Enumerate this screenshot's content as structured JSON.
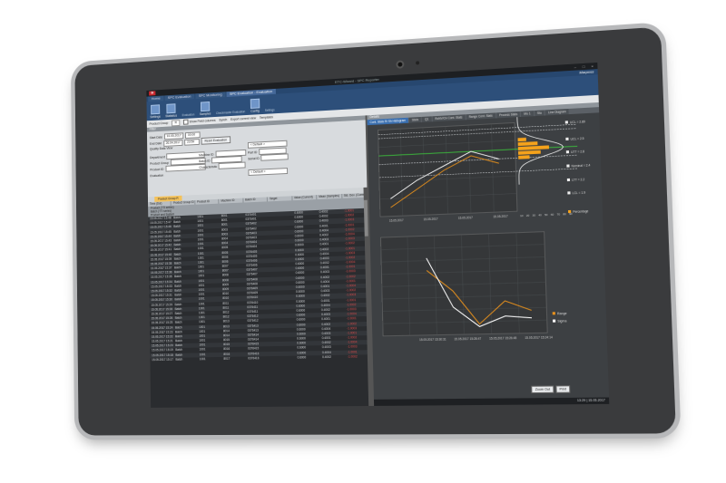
{
  "window": {
    "logo": "SI",
    "title": "ETC-Wizard - SPC Reporter",
    "min": "–",
    "max": "□",
    "close": "×"
  },
  "tabs": [
    "Home",
    "SPC Evaluation",
    "SPC Monitoring",
    "SPC Evaluation - Evaluation"
  ],
  "active_tab": 3,
  "brand": "Marposs",
  "ribbon": {
    "buttons": [
      "Settings",
      "Statistics",
      "Samples",
      "Config"
    ],
    "groups": [
      "Evaluation",
      "Checkmaster Evaluation",
      "Settings"
    ]
  },
  "toolbar": {
    "product_group_label": "Product Group",
    "product_group_value": "R",
    "show_fields": "Show Field columns",
    "synch": "Synch",
    "export": "Export current view",
    "templates": "Templates"
  },
  "filter": {
    "title": "Filter",
    "start_label": "Start Date",
    "start_value": "10.05.2017",
    "start_time": "00:00",
    "end_label": "End Date",
    "end_value": "26.04.2017",
    "end_time": "23:59",
    "reset_button": "Reset Evaluation",
    "quality_label": "Quality Data View",
    "default": "< Default >",
    "labels": [
      "Department",
      "Product Group",
      "Product ID",
      "Evaluation"
    ],
    "labels2": [
      "Machine ID",
      "Batch ID",
      "Characteristic"
    ],
    "labels3": [
      "Part ID",
      "Serial ID"
    ]
  },
  "grid": {
    "tab": "Product Group R",
    "headers": [
      "Time (Dat)",
      "Product Group ID",
      "Product ID",
      "Machine ID",
      "Batch ID",
      "Target",
      "Value (Current)",
      "Mean (Samples)",
      "Std. Dev. (Current)"
    ],
    "subrows": [
      "Product (TTI series)",
      "Batch (TTI series)",
      "Product and System"
    ],
    "rows": [
      [
        "15.05.2017 15:48:08",
        "Batch",
        "1001",
        "8001",
        "0376401",
        "",
        "0.6000",
        "0.4002",
        "-1.0001"
      ],
      [
        "15.05.2017 15:47:57",
        "Batch",
        "1001",
        "8001",
        "0376401",
        "",
        "0.6000",
        "0.4002",
        "-1.0002"
      ],
      [
        "15.05.2017 15:46:33",
        "Batch",
        "1001",
        "8001",
        "0376402",
        "",
        "0.6000",
        "0.4003",
        "-1.0003"
      ],
      [
        "15.05.2017 15:45:16",
        "Batch",
        "1001",
        "8003",
        "0376402",
        "",
        "0.6000",
        "0.4001",
        "-1.0001"
      ],
      [
        "15.05.2017 15:44:51",
        "Batch",
        "1001",
        "8003",
        "0376403",
        "",
        "0.6000",
        "0.4004",
        "-1.0002"
      ],
      [
        "15.05.2017 15:43:40",
        "Batch",
        "1001",
        "8004",
        "0376403",
        "",
        "0.6000",
        "0.4002",
        "-1.0004"
      ],
      [
        "15.05.2017 15:42:27",
        "Batch",
        "1001",
        "8004",
        "0376404",
        "",
        "0.6000",
        "0.4003",
        "-1.0003"
      ],
      [
        "15.05.2017 15:41:09",
        "Batch",
        "1001",
        "8005",
        "0376404",
        "",
        "0.6000",
        "0.4001",
        "-1.0002"
      ],
      [
        "15.05.2017 15:40:38",
        "Batch",
        "1001",
        "8005",
        "0376405",
        "",
        "0.6000",
        "0.4002",
        "-1.0001"
      ],
      [
        "15.05.2017 15:39:21",
        "Batch",
        "1001",
        "8006",
        "0376405",
        "",
        "0.6000",
        "0.4004",
        "-1.0003"
      ],
      [
        "15.05.2017 15:38:02",
        "Batch",
        "1001",
        "8006",
        "0376406",
        "",
        "0.6000",
        "0.4003",
        "-1.0002"
      ],
      [
        "15.05.2017 15:37:44",
        "Batch",
        "1001",
        "8007",
        "0376406",
        "",
        "0.6000",
        "0.4002",
        "-1.0004"
      ],
      [
        "15.05.2017 15:36:29",
        "Batch",
        "1001",
        "8007",
        "0376407",
        "",
        "0.6000",
        "0.4001",
        "-1.0001"
      ],
      [
        "15.05.2017 15:35:13",
        "Batch",
        "1001",
        "8008",
        "0376407",
        "",
        "0.6000",
        "0.4003",
        "-1.0003"
      ],
      [
        "15.05.2017 15:34:50",
        "Batch",
        "1001",
        "8008",
        "0376408",
        "",
        "0.6000",
        "0.4002",
        "-1.0002"
      ],
      [
        "15.05.2017 15:33:36",
        "Batch",
        "1001",
        "8009",
        "0376408",
        "",
        "0.6000",
        "0.4004",
        "-1.0001"
      ],
      [
        "15.05.2017 15:32:18",
        "Batch",
        "1001",
        "8009",
        "0376409",
        "",
        "0.6000",
        "0.4001",
        "-1.0004"
      ],
      [
        "15.05.2017 15:31:05",
        "Batch",
        "1001",
        "8010",
        "0376409",
        "",
        "0.6000",
        "0.4003",
        "-1.0002"
      ],
      [
        "15.05.2017 15:30:41",
        "Batch",
        "1001",
        "8010",
        "0376410",
        "",
        "0.6000",
        "0.4002",
        "-1.0003"
      ],
      [
        "15.05.2017 15:29:24",
        "Batch",
        "1001",
        "8011",
        "0376410",
        "",
        "0.6000",
        "0.4001",
        "-1.0001"
      ],
      [
        "15.05.2017 15:28:12",
        "Batch",
        "1001",
        "8011",
        "0376411",
        "",
        "0.6000",
        "0.4004",
        "-1.0002"
      ],
      [
        "15.05.2017 15:27:55",
        "Batch",
        "1001",
        "8012",
        "0376411",
        "",
        "0.6000",
        "0.4002",
        "-1.0003"
      ],
      [
        "15.05.2017 15:26:39",
        "Batch",
        "1001",
        "8012",
        "0376412",
        "",
        "0.6000",
        "0.4003",
        "-1.0004"
      ],
      [
        "15.05.2017 15:25:17",
        "Batch",
        "1001",
        "8013",
        "0376412",
        "",
        "0.6000",
        "0.4001",
        "-1.0001"
      ],
      [
        "15.05.2017 15:24:06",
        "Batch",
        "1001",
        "8013",
        "0376413",
        "",
        "0.6000",
        "0.4002",
        "-1.0002"
      ],
      [
        "15.05.2017 15:23:48",
        "Batch",
        "1001",
        "8014",
        "0376413",
        "",
        "0.6000",
        "0.4004",
        "-1.0003"
      ],
      [
        "15.05.2017 15:22:31",
        "Batch",
        "1001",
        "8014",
        "0376414",
        "",
        "0.6000",
        "0.4003",
        "-1.0001"
      ],
      [
        "15.05.2017 15:21:14",
        "Batch",
        "1001",
        "8015",
        "0376414",
        "",
        "0.6000",
        "0.4001",
        "-1.0002"
      ],
      [
        "15.05.2017 15:20:02",
        "Batch",
        "1001",
        "8015",
        "0376415",
        "",
        "0.6000",
        "0.4002",
        "-1.0004"
      ],
      [
        "15.05.2017 15:19:45",
        "Batch",
        "1001",
        "8016",
        "0376415",
        "",
        "0.6000",
        "0.4003",
        "-1.0003"
      ],
      [
        "15.05.2017 15:18:27",
        "Batch",
        "1001",
        "8016",
        "0376416",
        "",
        "0.6000",
        "0.4004",
        "-1.0001"
      ],
      [
        "15.05.2017 15:17:09",
        "Batch",
        "1001",
        "8017",
        "0376416",
        "",
        "0.6000",
        "0.4002",
        "-1.0002"
      ]
    ]
  },
  "details": {
    "title": "Details",
    "tabs": [
      "Cont. Stats R/ Sh Histogram",
      "Stats",
      "Q1",
      "RoNV/Ov Cont. Stats",
      "Range Cont. Stats",
      "Process Stats",
      "Mo 1",
      "Sta",
      "Line Diagram"
    ],
    "active_tab": 0,
    "legend": [
      {
        "label": "UCL = 2.89"
      },
      {
        "label": "UCL = 2.5"
      },
      {
        "label": "UTT = 2.8"
      },
      {
        "label": "Nominal = 2.4"
      },
      {
        "label": "LTT = 2.2"
      },
      {
        "label": "LCL = 1.9"
      },
      {
        "label": "Percentage"
      },
      {
        "label": "Range"
      },
      {
        "label": "Sigma"
      }
    ],
    "upper_x_ticks": [
      "15.05.2017",
      "15.05.2017",
      "15.05.2017",
      "15.05.2017"
    ],
    "hist_ticks": [
      "10",
      "20",
      "30",
      "40",
      "50",
      "60",
      "70",
      "80",
      "90"
    ],
    "lower_x_ticks": [
      "15.05.2017 15:30:31",
      "15.05.2017 15:28:47",
      "15.05.2017 15:26:45",
      "15.05.2017 15:24:14"
    ],
    "colors": {
      "mean": "#ffffff",
      "range": "#e8911c",
      "histogram": "#f5a21b",
      "nominal": "#3cc13c",
      "limit": "#d9dcdf"
    }
  },
  "buttons": {
    "zoom_out": "Zoom Out",
    "print": "Print"
  },
  "status": "13:29 | 15.05.2017",
  "chart_data": {
    "type": "line",
    "series": [
      {
        "name": "Range",
        "values": [
          1.2,
          1.6,
          2.0,
          2.3,
          2.1
        ]
      },
      {
        "name": "Sigma",
        "values": [
          1.4,
          1.8,
          2.1,
          2.4,
          2.2
        ]
      }
    ],
    "limits": {
      "UCL": 2.89,
      "UTT": 2.8,
      "Nominal": 2.4,
      "LTT": 2.2,
      "LCL": 1.9
    },
    "histogram": [
      {
        "bin": "2.2",
        "percentage": 20
      },
      {
        "bin": "2.3",
        "percentage": 40
      },
      {
        "bin": "2.4",
        "percentage": 55
      },
      {
        "bin": "2.5",
        "percentage": 35
      },
      {
        "bin": "2.6",
        "percentage": 15
      }
    ],
    "lower_series": [
      {
        "name": "Range",
        "values": [
          0.52,
          0.35,
          0.08,
          0.26,
          0.18
        ]
      },
      {
        "name": "Sigma",
        "values": [
          0.62,
          0.22,
          0.06,
          0.14,
          0.12
        ]
      }
    ],
    "legend_position": "right"
  }
}
